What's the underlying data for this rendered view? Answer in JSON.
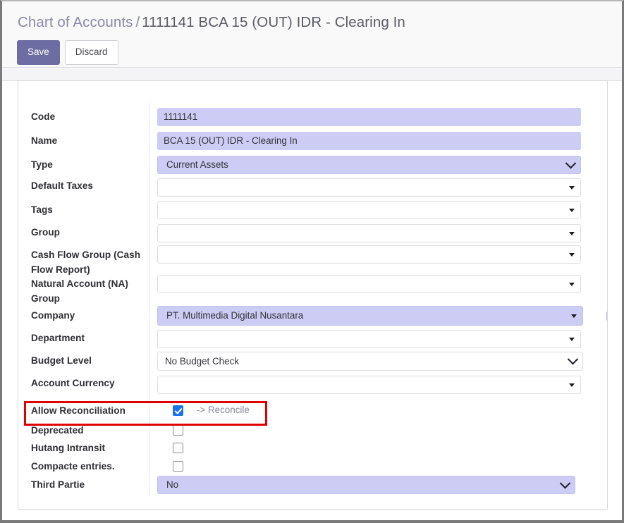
{
  "header": {
    "breadcrumb_root": "Chart of Accounts",
    "breadcrumb_separator": "/",
    "breadcrumb_current": "1111141 BCA 15 (OUT) IDR - Clearing In",
    "save_label": "Save",
    "discard_label": "Discard"
  },
  "colors": {
    "primary_button": "#6d6da4",
    "field_filled": "#ccccf4",
    "checkbox_checked": "#1a73e8",
    "highlight_box": "#e00000",
    "breadcrumb_link": "#8a8aa8",
    "link_text": "#86869c"
  },
  "form": {
    "fields": [
      {
        "label": "Code",
        "value": "1111141",
        "control": "text",
        "style": "filled",
        "caret": "none"
      },
      {
        "label": "Name",
        "value": "BCA 15 (OUT) IDR - Clearing In",
        "control": "text",
        "style": "filled",
        "caret": "none"
      },
      {
        "label": "Type",
        "value": "Current Assets",
        "control": "select",
        "style": "filled",
        "caret": "chevron"
      },
      {
        "label": "Default Taxes",
        "value": "",
        "control": "select",
        "style": "empty",
        "caret": "triangle"
      },
      {
        "label": "Tags",
        "value": "",
        "control": "select",
        "style": "empty",
        "caret": "triangle"
      },
      {
        "label": "Group",
        "value": "",
        "control": "select",
        "style": "empty",
        "caret": "triangle"
      },
      {
        "label": "Cash Flow Group (Cash Flow Report)",
        "value": "",
        "control": "select",
        "style": "empty",
        "caret": "triangle"
      },
      {
        "label": "Natural Account (NA) Group",
        "value": "",
        "control": "select",
        "style": "empty",
        "caret": "triangle"
      },
      {
        "label": "Company",
        "value": "PT. Multimedia Digital Nusantara",
        "control": "select",
        "style": "filled",
        "caret": "triangle"
      },
      {
        "label": "Department",
        "value": "",
        "control": "select",
        "style": "empty",
        "caret": "triangle"
      },
      {
        "label": "Budget Level",
        "value": "No Budget Check",
        "control": "select",
        "style": "white",
        "caret": "chevron"
      },
      {
        "label": "Account Currency",
        "value": "",
        "control": "select",
        "style": "empty",
        "caret": "triangle"
      },
      {
        "label": "Allow Reconciliation",
        "value": "",
        "control": "checkbox",
        "checked": true,
        "link_text": "-> Reconcile"
      },
      {
        "label": "Deprecated",
        "value": "",
        "control": "checkbox",
        "checked": false
      },
      {
        "label": "Hutang Intransit",
        "value": "",
        "control": "checkbox",
        "checked": false
      },
      {
        "label": "Compacte entries.",
        "value": "",
        "control": "checkbox",
        "checked": false
      },
      {
        "label": "Third Partie",
        "value": "No",
        "control": "select",
        "style": "filled",
        "caret": "chevron"
      }
    ]
  },
  "icons": {
    "external_link": "external-link-icon"
  }
}
